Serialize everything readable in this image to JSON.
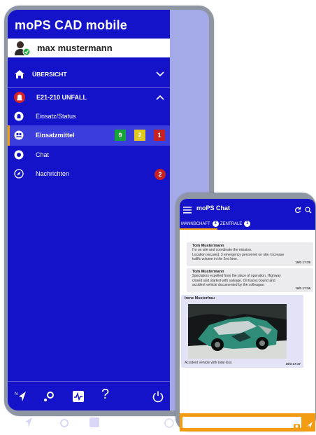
{
  "app": {
    "title": "moPS CAD mobile",
    "user": "max mustermann"
  },
  "nav": {
    "overview": "ÜBERSICHT",
    "incident": "E21-210 UNFALL",
    "items": [
      {
        "label": "Einsatz/Status"
      },
      {
        "label": "Einsatzmittel"
      },
      {
        "label": "Chat"
      },
      {
        "label": "Nachrichten"
      }
    ],
    "counts": {
      "green": "9",
      "yellow": "2",
      "red": "1"
    },
    "messages_badge": "2"
  },
  "bottombar": {
    "help": "?"
  },
  "colors": {
    "drawer": "#1413c9",
    "selected": "#3b3ddd",
    "accent": "#f39c12",
    "green": "#17a23a",
    "yellow": "#e3c91f",
    "red": "#c62222"
  },
  "chat": {
    "title": "moPS Chat",
    "tabs": [
      {
        "label": "MANNSCHAFT",
        "count": "3"
      },
      {
        "label": "ZENTRALE",
        "count": "1"
      }
    ],
    "messages": [
      {
        "author": "Tom Mustermann",
        "lines": [
          "I'm on site and coordinate the mission.",
          "Location secured. 3 emergency personnel on site. Increase",
          "traffic volume in the 2nd lane."
        ],
        "time": "19/3 17:35"
      },
      {
        "author": "Tom Mustermann",
        "lines": [
          "Spectators expelled from the place of operation. Highway",
          "closed and started with salvage. Oil traces bound and",
          "accident vehicle documented by the colleague."
        ],
        "time": "19/3 17:36"
      },
      {
        "author": "Irene Musterfrau",
        "caption": "Accident vehicle with total loss",
        "time": "19/3 17:37"
      }
    ]
  },
  "icons": {
    "user": "user-avatar-icon",
    "overview": "home-icon",
    "incident": "alarm-bell-icon",
    "menu": "hamburger-menu-icon",
    "refresh": "refresh-icon",
    "search": "search-icon",
    "camera": "camera-icon",
    "send": "send-icon",
    "power": "power-icon"
  }
}
